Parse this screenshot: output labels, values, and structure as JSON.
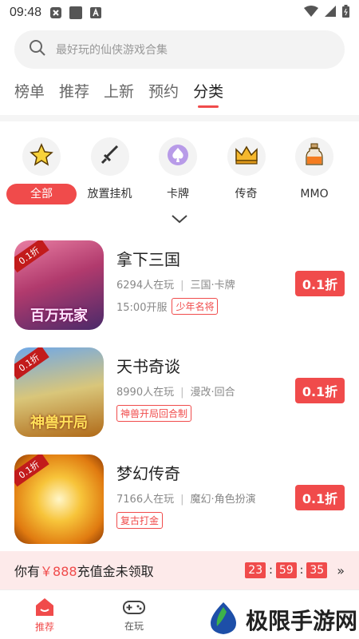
{
  "status": {
    "time": "09:48"
  },
  "search": {
    "placeholder": "最好玩的仙侠游戏合集"
  },
  "tabs": [
    {
      "label": "榜单"
    },
    {
      "label": "推荐"
    },
    {
      "label": "上新"
    },
    {
      "label": "预约"
    },
    {
      "label": "分类",
      "active": true
    }
  ],
  "categories": [
    {
      "label": "全部",
      "icon": "star-icon"
    },
    {
      "label": "放置挂机",
      "icon": "sword-icon"
    },
    {
      "label": "卡牌",
      "icon": "spade-card-icon"
    },
    {
      "label": "传奇",
      "icon": "crown-icon"
    },
    {
      "label": "MMO",
      "icon": "potion-icon"
    }
  ],
  "games": [
    {
      "name": "拿下三国",
      "players": "6294人在玩",
      "genre": "三国·卡牌",
      "server": "15:00开服",
      "tags": [
        "少年名将"
      ],
      "discount": "0.1折",
      "art_text": "百万玩家",
      "ribbon": "0.1折"
    },
    {
      "name": "天书奇谈",
      "players": "8990人在玩",
      "genre": "漫改·回合",
      "server": "",
      "tags": [
        "神兽开局回合制"
      ],
      "discount": "0.1折",
      "art_text": "神兽开局",
      "ribbon": "0.1折"
    },
    {
      "name": "梦幻传奇",
      "players": "7166人在玩",
      "genre": "魔幻·角色扮演",
      "server": "",
      "tags": [
        "复古打金"
      ],
      "discount": "0.1折",
      "art_text": "",
      "ribbon": "0.1折"
    }
  ],
  "promo": {
    "prefix": "你有",
    "amount": "￥888",
    "suffix": "充值金未领取",
    "hh": "23",
    "mm": "59",
    "ss": "35",
    "more": "»"
  },
  "nav": [
    {
      "label": "推荐",
      "active": true
    },
    {
      "label": "在玩"
    }
  ],
  "watermark": {
    "text": "极限手游网"
  },
  "colors": {
    "accent": "#f04b4b"
  }
}
